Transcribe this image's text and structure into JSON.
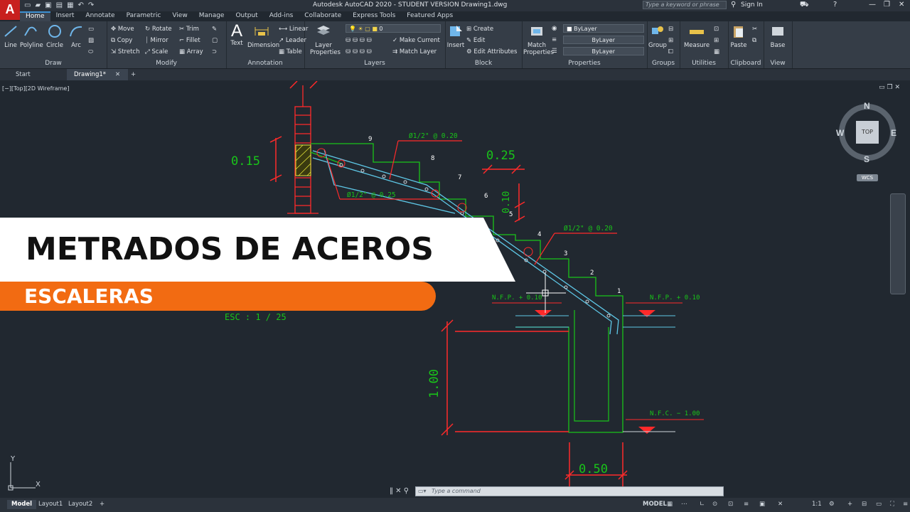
{
  "window": {
    "title": "Autodesk AutoCAD 2020 - STUDENT VERSION    Drawing1.dwg",
    "search_placeholder": "Type a keyword or phrase",
    "sign_in": "Sign In",
    "logo": "A"
  },
  "ribbon_tabs": [
    "Home",
    "Insert",
    "Annotate",
    "Parametric",
    "View",
    "Manage",
    "Output",
    "Add-ins",
    "Collaborate",
    "Express Tools",
    "Featured Apps"
  ],
  "panels": {
    "draw": {
      "title": "Draw",
      "line": "Line",
      "polyline": "Polyline",
      "circle": "Circle",
      "arc": "Arc"
    },
    "modify": {
      "title": "Modify",
      "move": "Move",
      "rotate": "Rotate",
      "trim": "Trim",
      "copy": "Copy",
      "mirror": "Mirror",
      "fillet": "Fillet",
      "stretch": "Stretch",
      "scale": "Scale",
      "array": "Array"
    },
    "annotation": {
      "title": "Annotation",
      "text": "Text",
      "dimension": "Dimension",
      "linear": "Linear",
      "leader": "Leader",
      "table": "Table"
    },
    "layers": {
      "title": "Layers",
      "layer_properties": "Layer Properties",
      "layer_value": "0",
      "make_current": "Make Current",
      "match_layer": "Match Layer"
    },
    "block": {
      "title": "Block",
      "insert": "Insert",
      "create": "Create",
      "edit": "Edit",
      "edit_attributes": "Edit Attributes"
    },
    "properties": {
      "title": "Properties",
      "match_properties": "Match Properties",
      "color": "ByLayer",
      "linetype": "ByLayer",
      "lineweight": "ByLayer"
    },
    "groups": {
      "title": "Groups",
      "group": "Group"
    },
    "utilities": {
      "title": "Utilities",
      "measure": "Measure"
    },
    "clipboard": {
      "title": "Clipboard",
      "paste": "Paste"
    },
    "view": {
      "title": "View",
      "base": "Base"
    }
  },
  "file_tabs": {
    "start": "Start",
    "drawing": "Drawing1*"
  },
  "viewport": {
    "label": "[−][Top][2D Wireframe]"
  },
  "viewcube": {
    "n": "N",
    "s": "S",
    "e": "E",
    "w": "W",
    "top": "TOP",
    "wcs": "WCS"
  },
  "drawing_text": {
    "dim_015": "0.15",
    "dim_025": "0.25",
    "dim_010": "0.10",
    "dim_100": "1.00",
    "dim_050": "0.50",
    "rebar_1": "Ø1/2\" @ 0.20",
    "rebar_2": "Ø1/2\" @ 0.25",
    "rebar_3": "Ø1/2\" @ 0.20",
    "steps": [
      "9",
      "8",
      "7",
      "6",
      "5",
      "4",
      "3",
      "2",
      "1"
    ],
    "nfp_left": "N.F.P. + 0.10",
    "nfp_right": "N.F.P. + 0.10",
    "nfc": "N.F.C. − 1.00",
    "esc": "ESC : 1 / 25"
  },
  "overlay": {
    "title": "METRADOS DE ACEROS",
    "subtitle": "ESCALERAS"
  },
  "ucs": {
    "x": "X",
    "y": "Y"
  },
  "command": {
    "placeholder": "Type a command"
  },
  "status": {
    "model": "Model",
    "layout1": "Layout1",
    "layout2": "Layout2",
    "model_btn": "MODEL",
    "scale": "1:1"
  },
  "colors": {
    "ribbon": "#353d47",
    "canvas": "#212830",
    "green": "#19c419",
    "cyan": "#5ec7e6",
    "red": "#ff2a2a",
    "orange": "#f26b12"
  }
}
